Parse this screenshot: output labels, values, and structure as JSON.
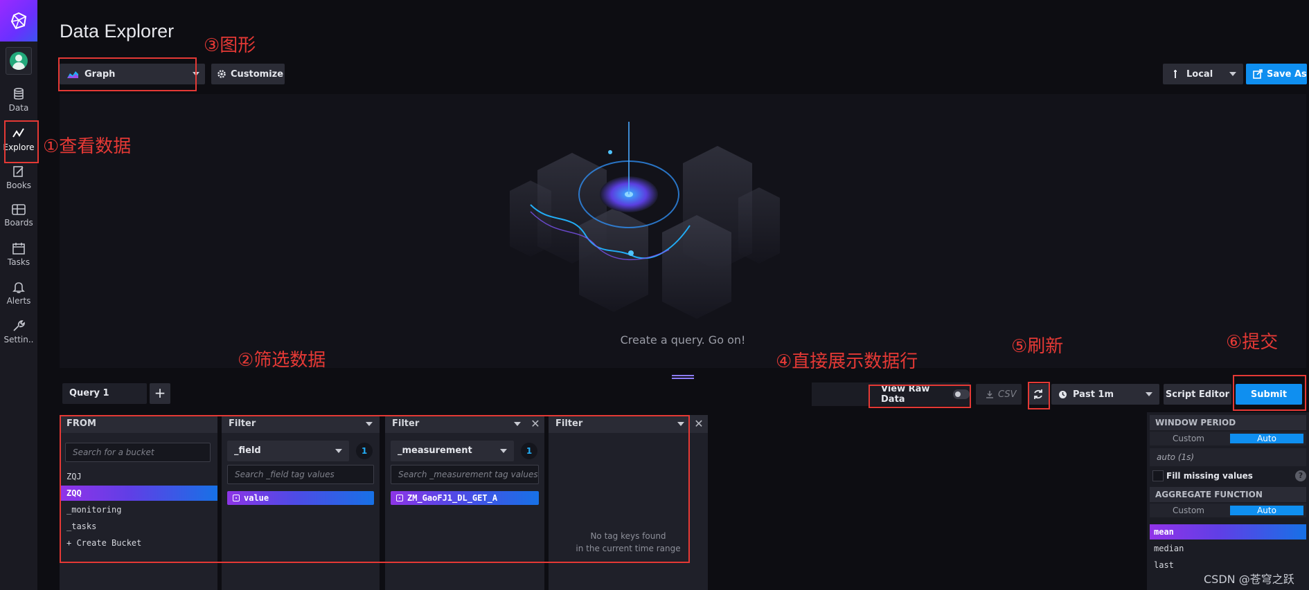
{
  "app": {
    "page_title": "Data Explorer"
  },
  "nav": {
    "items": [
      {
        "label": "Data",
        "icon": "database-icon"
      },
      {
        "label": "Explore",
        "icon": "graph-line-icon"
      },
      {
        "label": "Books",
        "icon": "notebook-icon"
      },
      {
        "label": "Boards",
        "icon": "dashboards-icon"
      },
      {
        "label": "Tasks",
        "icon": "calendar-icon"
      },
      {
        "label": "Alerts",
        "icon": "bell-icon"
      },
      {
        "label": "Settin..",
        "icon": "wrench-icon"
      }
    ],
    "active": "Explore"
  },
  "toolbar": {
    "vis_type": "Graph",
    "customize_label": "Customize",
    "timezone": "Local",
    "save_as_label": "Save As"
  },
  "graph": {
    "empty_message": "Create a query. Go on!"
  },
  "query_bar": {
    "tab_label": "Query 1",
    "add_label": "+",
    "raw_data_label": "View Raw Data",
    "csv_label": "CSV",
    "time_range": "Past 1m",
    "script_editor_label": "Script Editor",
    "submit_label": "Submit"
  },
  "builder": {
    "from": {
      "header": "FROM",
      "search_placeholder": "Search for a bucket",
      "buckets": [
        "ZQJ",
        "ZQQ",
        "_monitoring",
        "_tasks",
        "+ Create Bucket"
      ],
      "selected": "ZQQ"
    },
    "filters": [
      {
        "header": "Filter",
        "key": "_field",
        "count": "1",
        "search_placeholder": "Search _field tag values",
        "selected_value": "value"
      },
      {
        "header": "Filter",
        "key": "_measurement",
        "count": "1",
        "search_placeholder": "Search _measurement tag values",
        "selected_value": "ZM_GaoFJ1_DL_GET_A"
      },
      {
        "header": "Filter",
        "empty_line1": "No tag keys found",
        "empty_line2": "in the current time range"
      }
    ]
  },
  "aggregate": {
    "window_period_header": "WINDOW PERIOD",
    "custom_label": "Custom",
    "auto_label": "Auto",
    "period_value": "auto (1s)",
    "fill_missing_label": "Fill missing values",
    "help_label": "?",
    "aggregate_header": "AGGREGATE FUNCTION",
    "functions": [
      "mean",
      "median",
      "last"
    ],
    "selected_function": "mean"
  },
  "annotations": {
    "view_data": "①查看数据",
    "filter_data": "②筛选数据",
    "graph_type": "③图形",
    "raw_data": "④直接展示数据行",
    "refresh": "⑤刷新",
    "submit": "⑥提交",
    "annotation_color": "#e53935"
  },
  "watermark": "CSDN @苍穹之跃",
  "colors": {
    "accent": "#0f8ff0",
    "background": "#0d0d12",
    "selection_start": "#9233e8",
    "selection_end": "#1771e6"
  }
}
